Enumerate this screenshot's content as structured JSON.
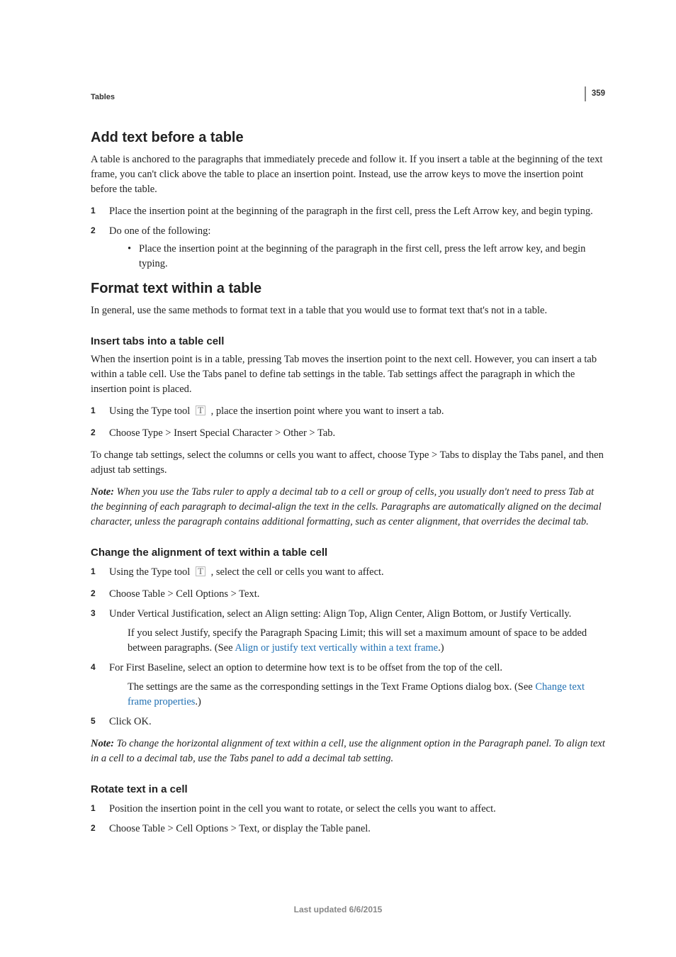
{
  "pageNumber": "359",
  "breadcrumb": "Tables",
  "footer": "Last updated 6/6/2015",
  "sections": {
    "s1": {
      "title": "Add text before a table",
      "p1": "A table is anchored to the paragraphs that immediately precede and follow it. If you insert a table at the beginning of the text frame, you can't click above the table to place an insertion point. Instead, use the arrow keys to move the insertion point before the table.",
      "step1": "Place the insertion point at the beginning of the paragraph in the first cell, press the Left Arrow key, and begin typing.",
      "step2": "Do one of the following:",
      "bullet1": "Place the insertion point at the beginning of the paragraph in the first cell, press the left arrow key, and begin typing."
    },
    "s2": {
      "title": "Format text within a table",
      "p1": "In general, use the same methods to format text in a table that you would use to format text that's not in a table."
    },
    "s3": {
      "title": "Insert tabs into a table cell",
      "p1": "When the insertion point is in a table, pressing Tab moves the insertion point to the next cell. However, you can insert a tab within a table cell. Use the Tabs panel to define tab settings in the table. Tab settings affect the paragraph in which the insertion point is placed.",
      "step1a": "Using the Type tool ",
      "step1b": " , place the insertion point where you want to insert a tab.",
      "step2": "Choose Type > Insert Special Character > Other > Tab.",
      "p2": "To change tab settings, select the columns or cells you want to affect, choose Type > Tabs to display the Tabs panel, and then adjust tab settings.",
      "noteLead": "Note: ",
      "note": "When you use the Tabs ruler to apply a decimal tab to a cell or group of cells, you usually don't need to press Tab at the beginning of each paragraph to decimal-align the text in the cells. Paragraphs are automatically aligned on the decimal character, unless the paragraph contains additional formatting, such as center alignment, that overrides the decimal tab."
    },
    "s4": {
      "title": "Change the alignment of text within a table cell",
      "step1a": "Using the Type tool ",
      "step1b": " , select the cell or cells you want to affect.",
      "step2": "Choose Table > Cell Options > Text.",
      "step3": "Under Vertical Justification, select an Align setting: Align Top, Align Center, Align Bottom, or Justify Vertically.",
      "step3body1a": "If you select Justify, specify the Paragraph Spacing Limit; this will set a maximum amount of space to be added between paragraphs. (See ",
      "step3body1link": "Align or justify text vertically within a text frame",
      "step3body1b": ".)",
      "step4": "For First Baseline, select an option to determine how text is to be offset from the top of the cell.",
      "step4body1a": "The settings are the same as the corresponding settings in the Text Frame Options dialog box. (See ",
      "step4body1link": "Change text frame properties",
      "step4body1b": ".)",
      "step5": "Click OK.",
      "noteLead": "Note: ",
      "note": "To change the horizontal alignment of text within a cell, use the alignment option in the Paragraph panel. To align text in a cell to a decimal tab, use the Tabs panel to add a decimal tab setting."
    },
    "s5": {
      "title": "Rotate text in a cell",
      "step1": "Position the insertion point in the cell you want to rotate, or select the cells you want to affect.",
      "step2": "Choose Table > Cell Options > Text, or display the Table panel."
    }
  }
}
